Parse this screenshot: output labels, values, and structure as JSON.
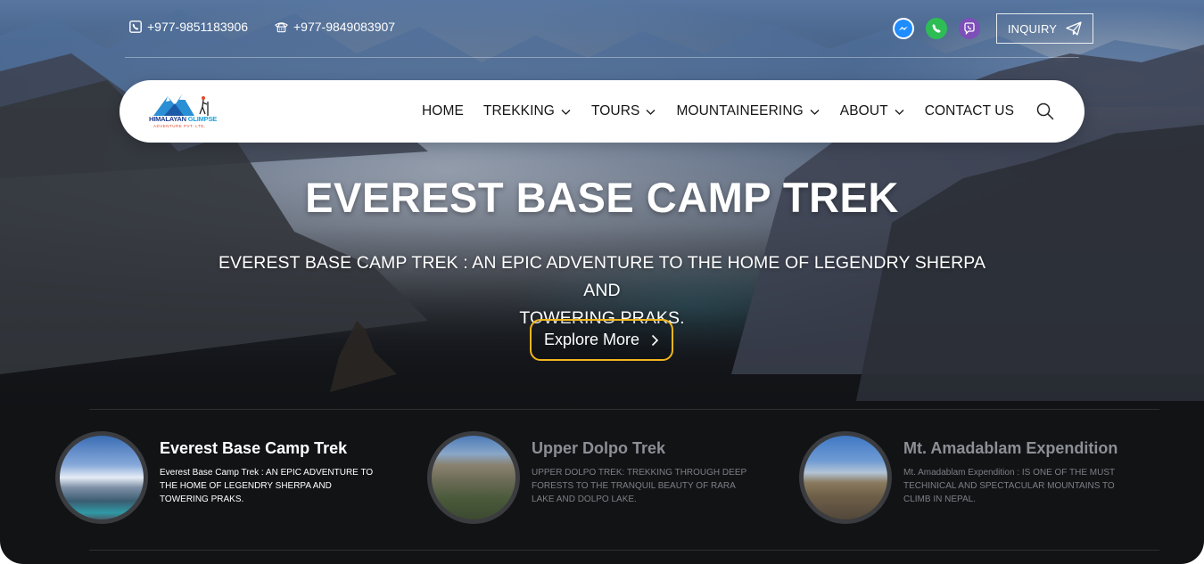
{
  "topbar": {
    "phone1": "+977-9851183906",
    "phone2": "+977-9849083907",
    "social": [
      "messenger-icon",
      "whatsapp-icon",
      "viber-icon"
    ],
    "inquiry_label": "INQUIRY"
  },
  "logo": {
    "line1a": "HIMALAYAN",
    "line1b": "GLIMPSE",
    "line2": "ADVENTURE PVT. LTD."
  },
  "nav": {
    "items": [
      {
        "label": "HOME",
        "dropdown": false
      },
      {
        "label": "TREKKING",
        "dropdown": true
      },
      {
        "label": "TOURS",
        "dropdown": true
      },
      {
        "label": "MOUNTAINEERING",
        "dropdown": true
      },
      {
        "label": "ABOUT",
        "dropdown": true
      },
      {
        "label": "CONTACT US",
        "dropdown": false
      }
    ]
  },
  "hero": {
    "title": "EVEREST BASE CAMP TREK",
    "subtitle_line1": "EVEREST BASE CAMP TREK : AN EPIC ADVENTURE TO THE HOME OF LEGENDRY SHERPA AND",
    "subtitle_line2": "TOWERING PRAKS.",
    "cta": "Explore More"
  },
  "cards": [
    {
      "title": "Everest Base Camp Trek",
      "desc": "Everest Base Camp Trek : AN EPIC ADVENTURE TO THE HOME OF LEGENDRY SHERPA AND TOWERING PRAKS.",
      "active": true
    },
    {
      "title": "Upper Dolpo Trek",
      "desc": "UPPER DOLPO TREK: TREKKING THROUGH DEEP FORESTS TO THE TRANQUIL BEAUTY OF RARA LAKE AND DOLPO LAKE.",
      "active": false
    },
    {
      "title": "Mt. Amadablam Expendition",
      "desc": "Mt. Amadablam Expendition : IS ONE OF THE MUST TECHINICAL AND SPECTACULAR MOUNTAINS TO CLIMB IN NEPAL.",
      "active": false
    }
  ],
  "colors": {
    "accent": "#f2b61d",
    "whatsapp": "#2ebd55",
    "viber": "#7d4fb8",
    "messenger": "#0a7cff"
  }
}
